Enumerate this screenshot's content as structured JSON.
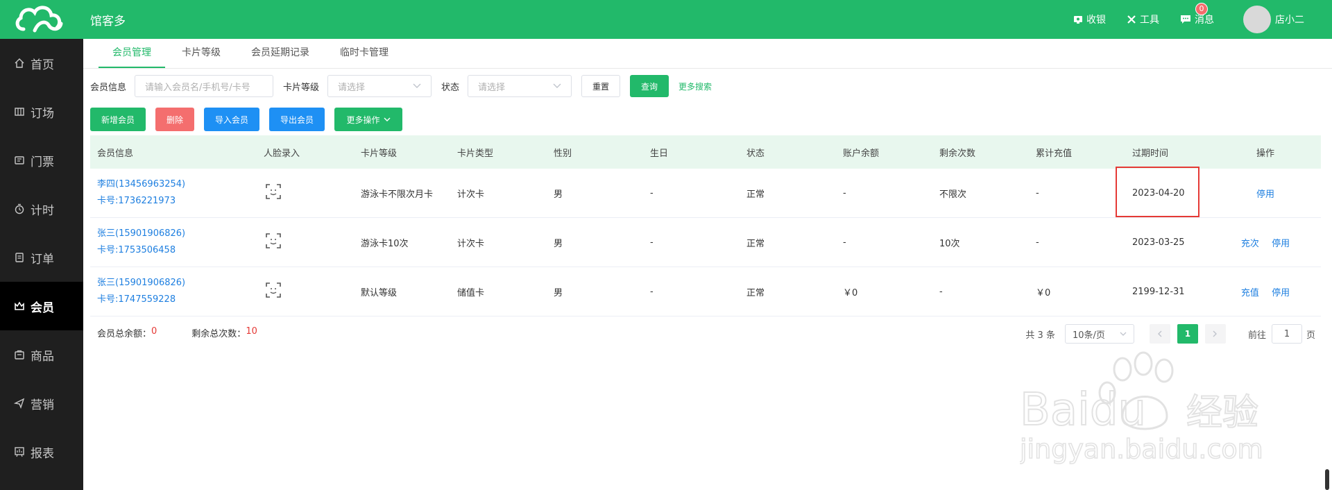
{
  "header": {
    "app_name": "馆客多",
    "actions": [
      {
        "label": "收银",
        "icon": "cashier-icon"
      },
      {
        "label": "工具",
        "icon": "tools-icon"
      },
      {
        "label": "消息",
        "icon": "message-icon",
        "badge": "0"
      }
    ],
    "user_name": "店小二"
  },
  "sidebar": {
    "items": [
      {
        "label": "首页",
        "icon": "home-icon"
      },
      {
        "label": "订场",
        "icon": "venue-icon"
      },
      {
        "label": "门票",
        "icon": "ticket-icon"
      },
      {
        "label": "计时",
        "icon": "timer-icon"
      },
      {
        "label": "订单",
        "icon": "order-icon"
      },
      {
        "label": "会员",
        "icon": "member-icon",
        "active": true
      },
      {
        "label": "商品",
        "icon": "goods-icon"
      },
      {
        "label": "营销",
        "icon": "marketing-icon"
      },
      {
        "label": "报表",
        "icon": "report-icon"
      }
    ]
  },
  "tabs": [
    {
      "label": "会员管理",
      "active": true
    },
    {
      "label": "卡片等级"
    },
    {
      "label": "会员延期记录"
    },
    {
      "label": "临时卡管理"
    }
  ],
  "filters": {
    "member_label": "会员信息",
    "member_placeholder": "请输入会员名/手机号/卡号",
    "level_label": "卡片等级",
    "level_placeholder": "请选择",
    "status_label": "状态",
    "status_placeholder": "请选择",
    "reset_label": "重置",
    "query_label": "查询",
    "more_search_label": "更多搜索"
  },
  "toolbar": {
    "add_label": "新增会员",
    "delete_label": "删除",
    "import_label": "导入会员",
    "export_label": "导出会员",
    "more_label": "更多操作"
  },
  "table": {
    "headers": [
      "会员信息",
      "人脸录入",
      "卡片等级",
      "卡片类型",
      "性别",
      "生日",
      "状态",
      "账户余额",
      "剩余次数",
      "累计充值",
      "过期时间",
      "操作"
    ],
    "rows": [
      {
        "name": "李四(13456963254)",
        "card": "卡号:1736221973",
        "level": "游泳卡不限次月卡",
        "type": "计次卡",
        "gender": "男",
        "birthday": "-",
        "status": "正常",
        "balance": "-",
        "remaining": "不限次",
        "recharge": "-",
        "expire": "2023-04-20",
        "ops": [
          "停用"
        ]
      },
      {
        "name": "张三(15901906826)",
        "card": "卡号:1753506458",
        "level": "游泳卡10次",
        "type": "计次卡",
        "gender": "男",
        "birthday": "-",
        "status": "正常",
        "balance": "-",
        "remaining": "10次",
        "recharge": "-",
        "expire": "2023-03-25",
        "ops": [
          "充次",
          "停用"
        ]
      },
      {
        "name": "张三(15901906826)",
        "card": "卡号:1747559228",
        "level": "默认等级",
        "type": "储值卡",
        "gender": "男",
        "birthday": "-",
        "status": "正常",
        "balance": "￥0",
        "remaining": "-",
        "recharge": "￥0",
        "expire": "2199-12-31",
        "ops": [
          "充值",
          "停用"
        ]
      }
    ]
  },
  "summary": {
    "balance_label": "会员总余额：",
    "balance_value": "0",
    "count_label": "剩余总次数：",
    "count_value": "10"
  },
  "pagination": {
    "total_text": "共 3 条",
    "page_size": "10条/页",
    "current_page": "1",
    "goto_label": "前往",
    "goto_value": "1",
    "page_suffix": "页"
  },
  "watermark": {
    "brand": "Baidu",
    "brand_cn": "经验",
    "url": "jingyan.baidu.com"
  },
  "colors": {
    "brand_green": "#22b96a",
    "sidebar_bg": "#1f1f1f",
    "link_blue": "#1e7fe0",
    "highlight_red": "#e53935"
  }
}
